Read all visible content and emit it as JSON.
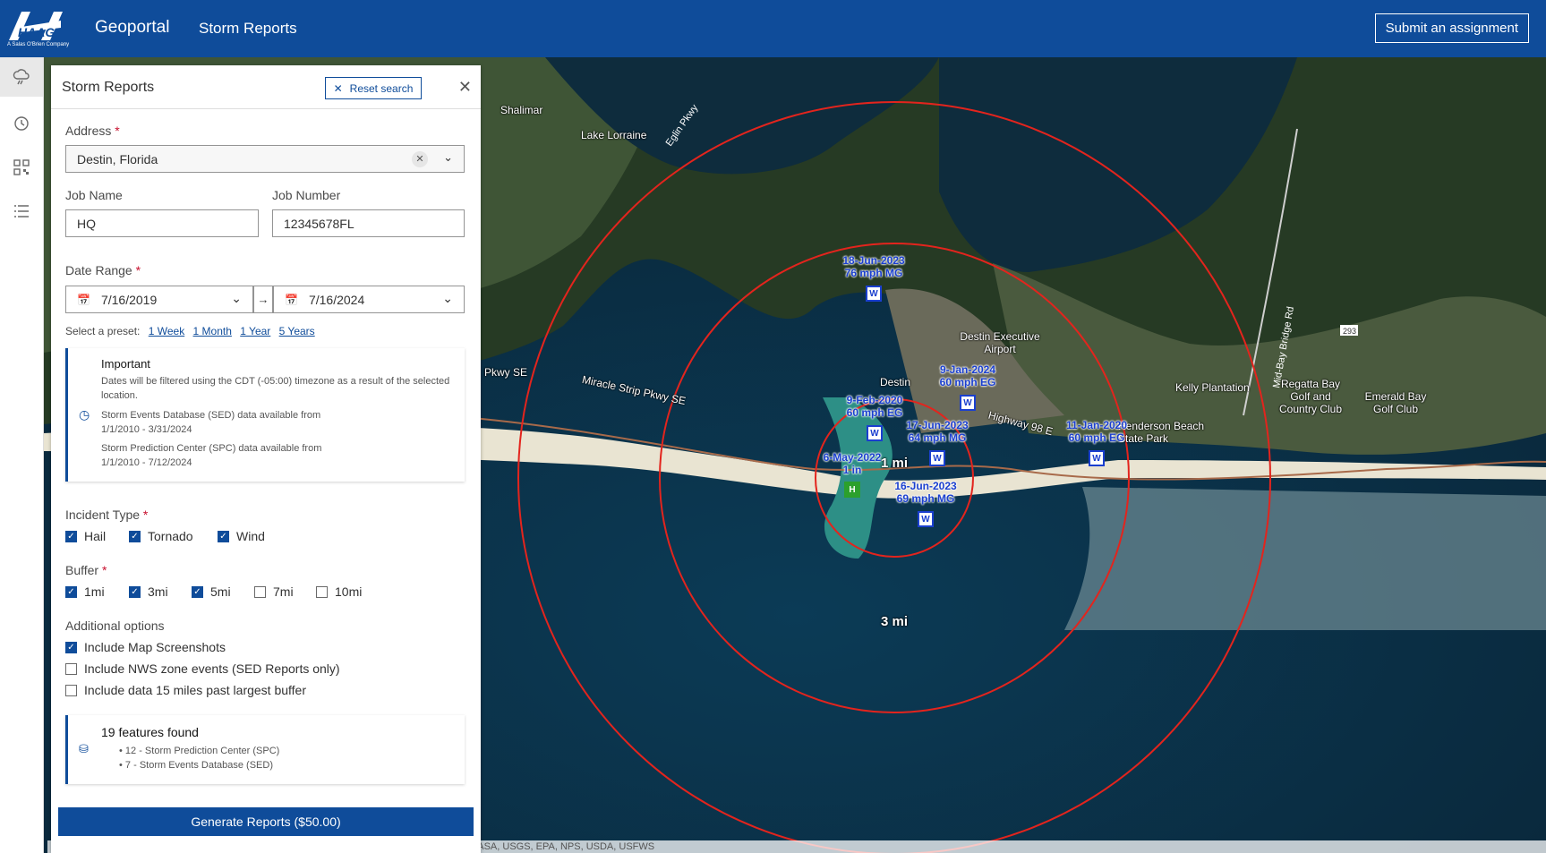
{
  "header": {
    "logo_text": "HAAG",
    "logo_sub": "A Salas O'Brien Company",
    "app_title": "Geoportal",
    "app_subtitle": "Storm Reports",
    "submit_label": "Submit an assignment"
  },
  "strip": {
    "icons": [
      "storm-icon",
      "history-icon",
      "qr-icon",
      "list-icon"
    ],
    "expand_label": "»"
  },
  "panel": {
    "title": "Storm Reports",
    "reset_label": "Reset search",
    "address_label": "Address",
    "address_value": "Destin, Florida",
    "job_name_label": "Job Name",
    "job_name_value": "HQ",
    "job_number_label": "Job Number",
    "job_number_value": "12345678FL",
    "date_range_label": "Date Range",
    "date_start": "7/16/2019",
    "date_end": "7/16/2024",
    "preset_label": "Select a preset:",
    "presets": [
      "1 Week",
      "1 Month",
      "1 Year",
      "5 Years"
    ],
    "important_title": "Important",
    "important_text": "Dates will be filtered using the CDT (-05:00) timezone as a result of the selected location.",
    "sed_text": "Storm Events Database (SED) data available from",
    "sed_range": "1/1/2010 - 3/31/2024",
    "spc_text": "Storm Prediction Center (SPC) data available from",
    "spc_range": "1/1/2010 - 7/12/2024",
    "incident_label": "Incident Type",
    "incidents": [
      {
        "label": "Hail",
        "checked": true
      },
      {
        "label": "Tornado",
        "checked": true
      },
      {
        "label": "Wind",
        "checked": true
      }
    ],
    "buffer_label": "Buffer",
    "buffers": [
      {
        "label": "1mi",
        "checked": true
      },
      {
        "label": "3mi",
        "checked": true
      },
      {
        "label": "5mi",
        "checked": true
      },
      {
        "label": "7mi",
        "checked": false
      },
      {
        "label": "10mi",
        "checked": false
      }
    ],
    "additional_label": "Additional options",
    "options": [
      {
        "label": "Include Map Screenshots",
        "checked": true
      },
      {
        "label": "Include NWS zone events (SED Reports only)",
        "checked": false
      },
      {
        "label": "Include data 15 miles past largest buffer",
        "checked": false
      }
    ],
    "features_title": "19 features found",
    "features": [
      "12 - Storm Prediction Center (SPC)",
      "7 - Storm Events Database (SED)"
    ],
    "generate_label": "Generate Reports ($50.00)"
  },
  "map": {
    "attribution": "Earthstar Geographics | FDEP, Esri, TomTom, Garmin, SafeGraph, GeoTechnologies, Inc, METI/NASA, USGS, EPA, NPS, USDA, USFWS",
    "place_labels": [
      "Shalimar",
      "Lake Lorraine",
      "Destin",
      "Destin Executive Airport",
      "Kelly Plantation",
      "Regatta Bay Golf and Country Club",
      "Emerald Bay Golf Club",
      "Henderson Beach State Park",
      "Miracle Strip Pkwy SE",
      "Highway 98 E",
      "Mid-Bay Bridge Rd",
      "Eglin Pkwy",
      "Pkwy SE",
      "293"
    ],
    "ring_labels": [
      "1 mi",
      "3 mi"
    ],
    "events": [
      {
        "date": "18-Jun-2023",
        "detail": "76 mph MG",
        "type": "W"
      },
      {
        "date": "9-Jan-2024",
        "detail": "60 mph EG",
        "type": "W"
      },
      {
        "date": "9-Feb-2020",
        "detail": "60 mph EG",
        "type": "W"
      },
      {
        "date": "17-Jun-2023",
        "detail": "64 mph MG",
        "type": "W"
      },
      {
        "date": "11-Jan-2020",
        "detail": "60 mph EG",
        "type": "W"
      },
      {
        "date": "6-May-2022",
        "detail": "1 in",
        "type": "H"
      },
      {
        "date": "16-Jun-2023",
        "detail": "69 mph MG",
        "type": "W"
      }
    ]
  }
}
